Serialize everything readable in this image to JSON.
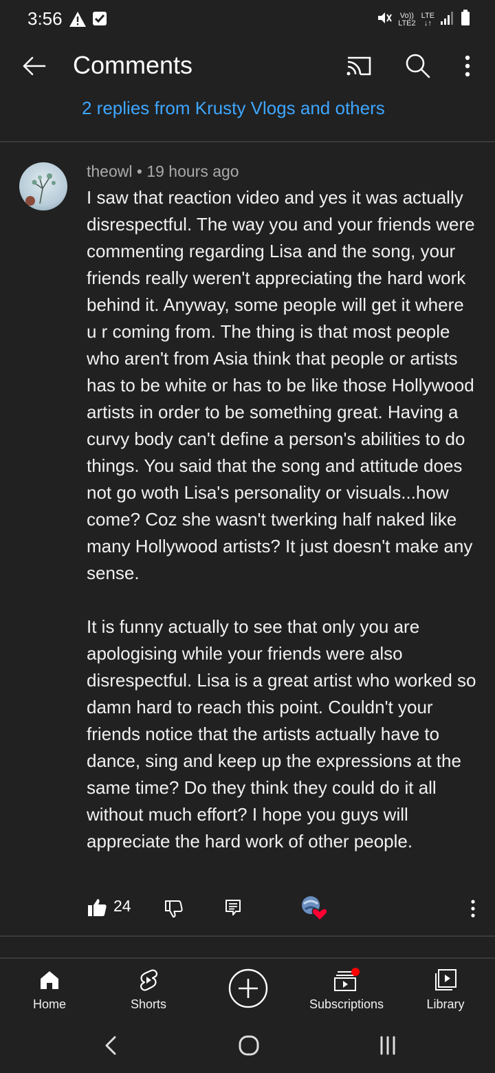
{
  "status_bar": {
    "time": "3:56",
    "volte_label": "Vo))",
    "lte_label": "LTE",
    "lte2_label": "LTE2"
  },
  "header": {
    "title": "Comments"
  },
  "thread": {
    "replies_link": "2 replies from Krusty Vlogs and others"
  },
  "comment": {
    "author": "theowl",
    "separator": "•",
    "time_ago": "19 hours ago",
    "body": "I saw that reaction video and yes it was actually disrespectful. The way you and your friends were commenting regarding Lisa and the song, your friends really weren't appreciating the hard work behind it. Anyway, some people will get it where u r coming from. The thing is that most people who aren't from Asia think that people or artists has to be white or has to be like those Hollywood artists in order to be something great. Having a curvy body can't define a person's abilities to do things. You said that the song and attitude does not go woth Lisa's personality or visuals...how come? Coz she wasn't twerking half naked like many Hollywood artists? It just doesn't make any sense.\n\nIt is funny actually to see that only you are apologising while your friends were also disrespectful. Lisa is a great artist who worked so damn hard to reach this point. Couldn't your friends notice that the artists actually have to dance, sing and keep up the expressions at the same time? Do they think they could do it all without much effort? I hope you guys will appreciate the hard work of other people.",
    "like_count": "24"
  },
  "bottom_nav": {
    "items": [
      {
        "label": "Home",
        "icon": "home-icon"
      },
      {
        "label": "Shorts",
        "icon": "shorts-icon"
      },
      {
        "label": "Subscriptions",
        "icon": "subscriptions-icon"
      },
      {
        "label": "Library",
        "icon": "library-icon"
      }
    ],
    "create_icon": "create-plus-icon"
  },
  "colors": {
    "background": "#212121",
    "link": "#3ea6ff",
    "heart": "#ff0033",
    "notification_dot": "#ff0000"
  }
}
